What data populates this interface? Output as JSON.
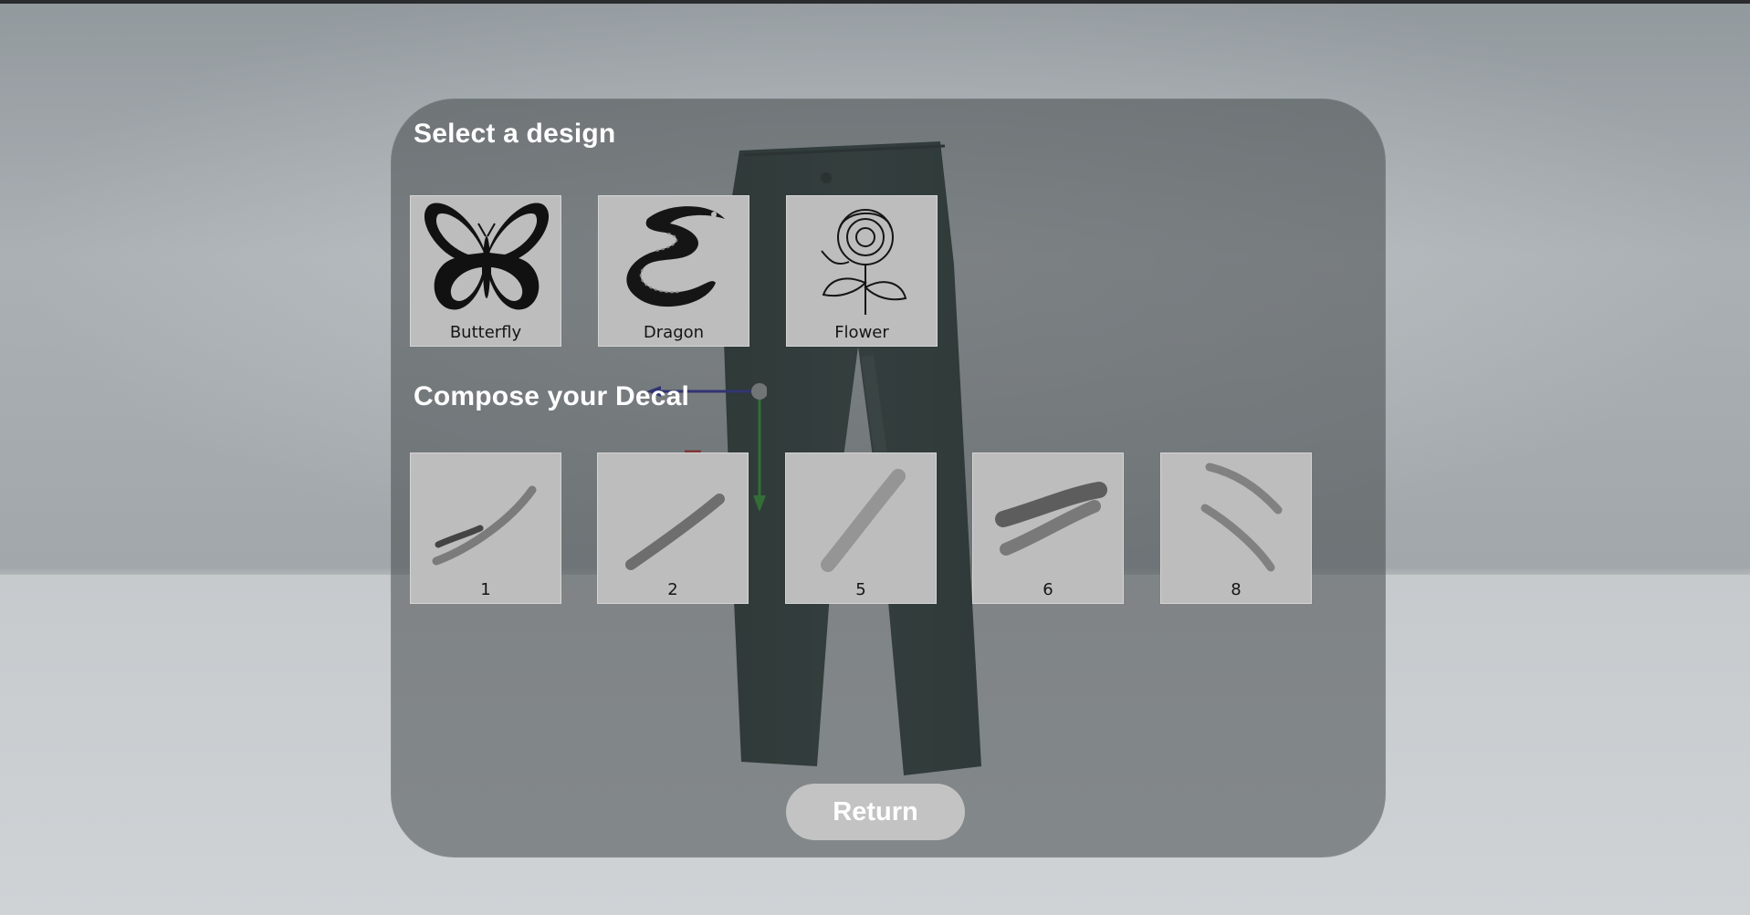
{
  "panel": {
    "design_title": "Select a design",
    "decal_title": "Compose your Decal",
    "return_label": "Return"
  },
  "designs": [
    {
      "label": "Butterfly",
      "icon": "butterfly-icon"
    },
    {
      "label": "Dragon",
      "icon": "dragon-icon"
    },
    {
      "label": "Flower",
      "icon": "rose-icon"
    }
  ],
  "decals": [
    {
      "label": "1",
      "icon": "brush-stroke-icon"
    },
    {
      "label": "2",
      "icon": "brush-stroke-icon"
    },
    {
      "label": "5",
      "icon": "brush-stroke-icon"
    },
    {
      "label": "6",
      "icon": "brush-stroke-icon"
    },
    {
      "label": "8",
      "icon": "brush-stroke-icon"
    }
  ],
  "colors": {
    "panel_bg": "#464a4d",
    "tile_bg": "#bdbdbd",
    "button_bg": "#c3c3c3",
    "gizmo_x": "#1a1aa0",
    "gizmo_y": "#1e9a1e",
    "jeans": "#1c2b28"
  }
}
